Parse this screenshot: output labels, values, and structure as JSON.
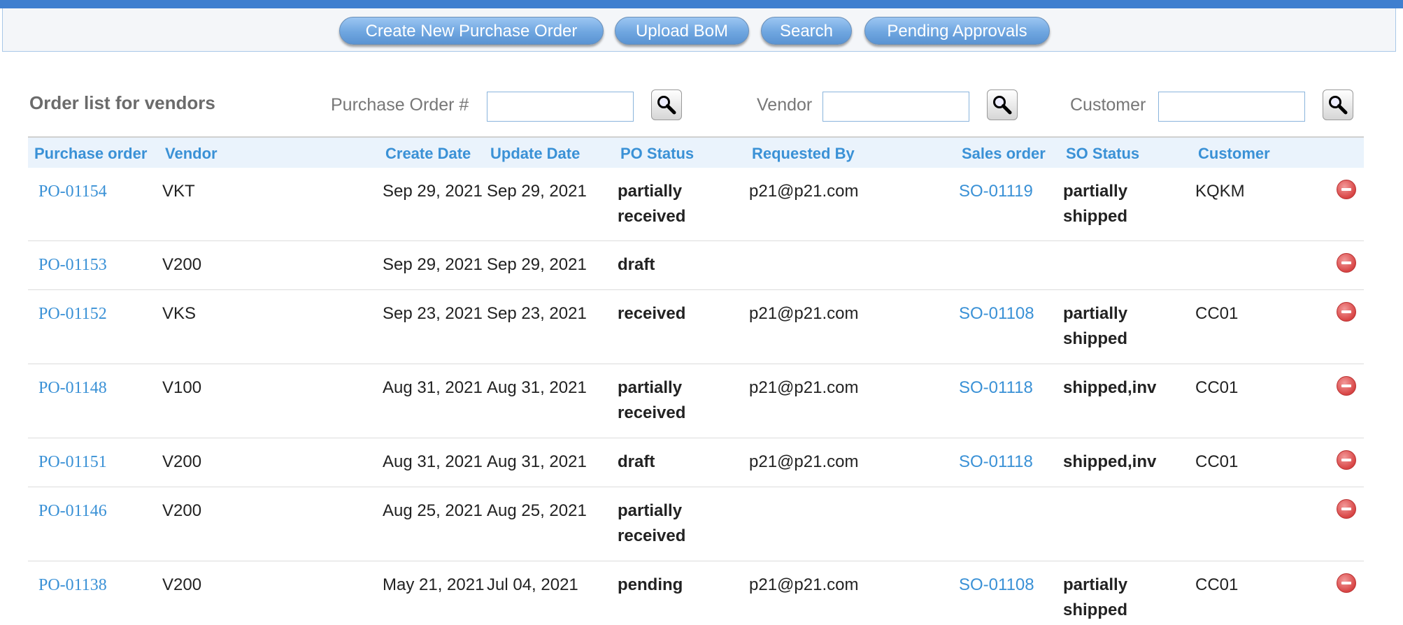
{
  "toolbar": {
    "create_po": "Create New Purchase Order",
    "upload_bom": "Upload BoM",
    "search": "Search",
    "pending_approvals": "Pending Approvals"
  },
  "filters": {
    "heading": "Order list for vendors",
    "po_label": "Purchase Order #",
    "vendor_label": "Vendor",
    "customer_label": "Customer",
    "po_value": "",
    "vendor_value": "",
    "customer_value": ""
  },
  "table": {
    "headers": {
      "purchase_order": "Purchase order",
      "vendor": "Vendor",
      "create_date": "Create Date",
      "update_date": "Update Date",
      "po_status": "PO Status",
      "requested_by": "Requested By",
      "sales_order": "Sales order",
      "so_status": "SO Status",
      "customer": "Customer"
    },
    "rows": [
      {
        "po": "PO-01154",
        "vendor": "VKT",
        "created": "Sep 29, 2021",
        "updated": "Sep 29, 2021",
        "po_status": [
          "partially",
          "received"
        ],
        "requested_by": "p21@p21.com",
        "so": "SO-01119",
        "so_status": [
          "partially",
          "shipped"
        ],
        "customer": "KQKM"
      },
      {
        "po": "PO-01153",
        "vendor": "V200",
        "created": "Sep 29, 2021",
        "updated": "Sep 29, 2021",
        "po_status": [
          "draft"
        ],
        "requested_by": "",
        "so": "",
        "so_status": [],
        "customer": ""
      },
      {
        "po": "PO-01152",
        "vendor": "VKS",
        "created": "Sep 23, 2021",
        "updated": "Sep 23, 2021",
        "po_status": [
          "received"
        ],
        "requested_by": "p21@p21.com",
        "so": "SO-01108",
        "so_status": [
          "partially",
          "shipped"
        ],
        "customer": "CC01"
      },
      {
        "po": "PO-01148",
        "vendor": "V100",
        "created": "Aug 31, 2021",
        "updated": "Aug 31, 2021",
        "po_status": [
          "partially",
          "received"
        ],
        "requested_by": "p21@p21.com",
        "so": "SO-01118",
        "so_status": [
          "shipped,inv"
        ],
        "customer": "CC01"
      },
      {
        "po": "PO-01151",
        "vendor": "V200",
        "created": "Aug 31, 2021",
        "updated": "Aug 31, 2021",
        "po_status": [
          "draft"
        ],
        "requested_by": "p21@p21.com",
        "so": "SO-01118",
        "so_status": [
          "shipped,inv"
        ],
        "customer": "CC01"
      },
      {
        "po": "PO-01146",
        "vendor": "V200",
        "created": "Aug 25, 2021",
        "updated": "Aug 25, 2021",
        "po_status": [
          "partially",
          "received"
        ],
        "requested_by": "",
        "so": "",
        "so_status": [],
        "customer": ""
      },
      {
        "po": "PO-01138",
        "vendor": "V200",
        "created": "May 21, 2021",
        "updated": "Jul 04, 2021",
        "po_status": [
          "pending"
        ],
        "requested_by": "p21@p21.com",
        "so": "SO-01108",
        "so_status": [
          "partially",
          "shipped"
        ],
        "customer": "CC01"
      }
    ]
  },
  "icons": {
    "search": "magnifier-icon",
    "delete": "remove-circle-icon"
  }
}
